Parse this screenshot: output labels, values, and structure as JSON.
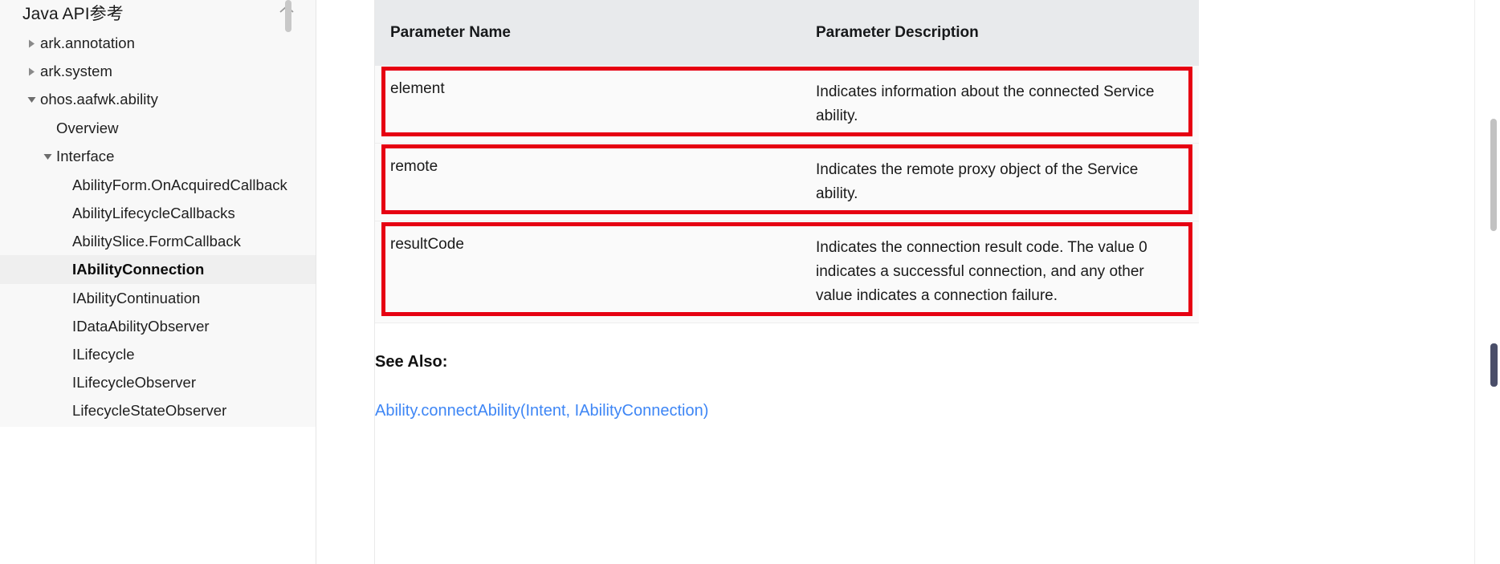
{
  "sidebar": {
    "title": "Java API参考",
    "collapse_icon": "chevron-up-icon",
    "items": [
      {
        "label": "ark.annotation",
        "indent": 0,
        "arrow": "right",
        "selected": false,
        "bold": false
      },
      {
        "label": "ark.system",
        "indent": 0,
        "arrow": "right",
        "selected": false,
        "bold": false
      },
      {
        "label": "ohos.aafwk.ability",
        "indent": 0,
        "arrow": "down",
        "selected": false,
        "bold": false
      },
      {
        "label": "Overview",
        "indent": 1,
        "arrow": "none",
        "selected": false,
        "bold": false
      },
      {
        "label": "Interface",
        "indent": 1,
        "arrow": "down",
        "selected": false,
        "bold": false
      },
      {
        "label": "AbilityForm.OnAcquiredCallback",
        "indent": 2,
        "arrow": "none",
        "selected": false,
        "bold": false
      },
      {
        "label": "AbilityLifecycleCallbacks",
        "indent": 2,
        "arrow": "none",
        "selected": false,
        "bold": false
      },
      {
        "label": "AbilitySlice.FormCallback",
        "indent": 2,
        "arrow": "none",
        "selected": false,
        "bold": false
      },
      {
        "label": "IAbilityConnection",
        "indent": 2,
        "arrow": "none",
        "selected": true,
        "bold": true
      },
      {
        "label": "IAbilityContinuation",
        "indent": 2,
        "arrow": "none",
        "selected": false,
        "bold": false
      },
      {
        "label": "IDataAbilityObserver",
        "indent": 2,
        "arrow": "none",
        "selected": false,
        "bold": false
      },
      {
        "label": "ILifecycle",
        "indent": 2,
        "arrow": "none",
        "selected": false,
        "bold": false
      },
      {
        "label": "ILifecycleObserver",
        "indent": 2,
        "arrow": "none",
        "selected": false,
        "bold": false
      },
      {
        "label": "LifecycleStateObserver",
        "indent": 2,
        "arrow": "none",
        "selected": false,
        "bold": false
      }
    ]
  },
  "table": {
    "headers": {
      "name": "Parameter Name",
      "description": "Parameter Description"
    },
    "rows": [
      {
        "name": "element",
        "description": "Indicates information about the connected Service ability.",
        "highlighted": true
      },
      {
        "name": "remote",
        "description": "Indicates the remote proxy object of the Service ability.",
        "highlighted": true
      },
      {
        "name": "resultCode",
        "description": "Indicates the connection result code. The value 0 indicates a successful connection, and any other value indicates a connection failure.",
        "highlighted": true
      }
    ]
  },
  "see_also": {
    "heading": "See Also:",
    "link": "Ability.connectAbility(Intent, IAbilityConnection)"
  },
  "colors": {
    "annotation_red": "#e60012",
    "link_blue": "#3e86f5",
    "table_header_bg": "#e8eaec",
    "sidebar_bg": "#f8f8f8",
    "selected_row_bg": "#efefef"
  }
}
